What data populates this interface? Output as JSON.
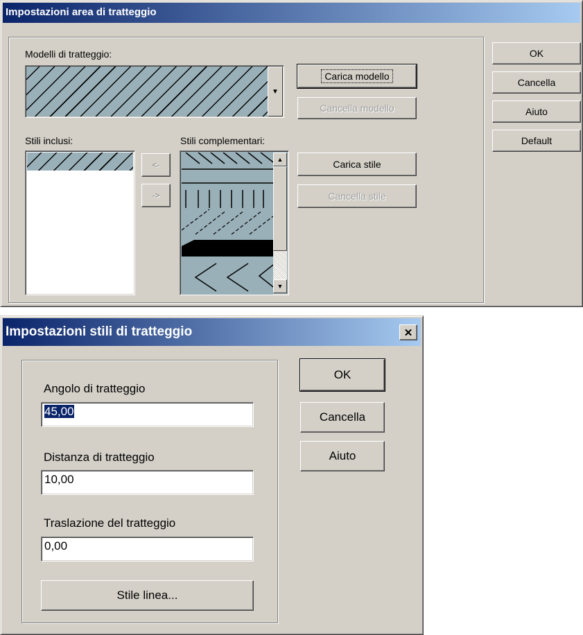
{
  "dialog1": {
    "title": "Impostazioni area di tratteggio",
    "models_label": "Modelli di tratteggio:",
    "load_model": "Carica modello",
    "delete_model": "Cancella modello",
    "included_label": "Stili inclusi:",
    "complementary_label": "Stili complementari:",
    "move_left": "<-",
    "move_right": "->",
    "load_style": "Carica stile",
    "delete_style": "Cancella stile",
    "ok": "OK",
    "cancel": "Cancella",
    "help": "Aiuto",
    "default": "Default"
  },
  "dialog2": {
    "title": "Impostazioni stili di tratteggio",
    "close": "✕",
    "angle_label": "Angolo di tratteggio",
    "angle_value": "45,00",
    "distance_label": "Distanza di tratteggio",
    "distance_value": "10,00",
    "offset_label": "Traslazione del tratteggio",
    "offset_value": "0,00",
    "line_style": "Stile linea...",
    "ok": "OK",
    "cancel": "Cancella",
    "help": "Aiuto"
  },
  "icons": {
    "dropdown": "triangle-down",
    "scroll_up": "triangle-up",
    "scroll_down": "triangle-down"
  },
  "colors": {
    "face": "#d4d0c8",
    "title_start": "#0a246a",
    "title_end": "#a6caf0",
    "hatch_bg": "#99b0b8",
    "selection": "#0a246a"
  }
}
